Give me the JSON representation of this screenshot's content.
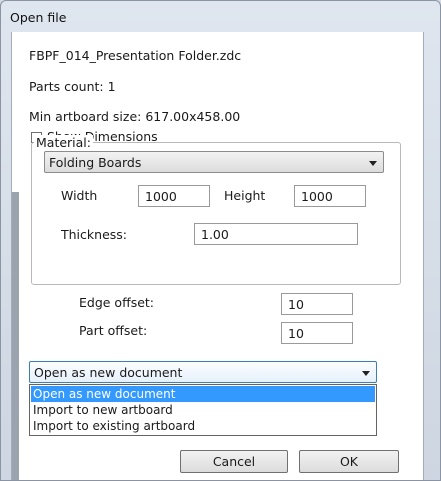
{
  "window": {
    "title": "Open file"
  },
  "info": {
    "filename": "FBPF_014_Presentation Folder.zdc",
    "parts_count": "Parts count:  1",
    "min_artboard": "Min artboard size:  617.00x458.00"
  },
  "show_dimensions": {
    "label": "Show Dimensions",
    "checked": false
  },
  "material": {
    "title": "Material:",
    "selected": "Folding Boards",
    "width_label": "Width",
    "width_value": "1000",
    "height_label": "Height",
    "height_value": "1000",
    "thickness_label": "Thickness:",
    "thickness_value": "1.00"
  },
  "offsets": {
    "edge_label": "Edge offset:",
    "edge_value": "10",
    "part_label": "Part offset:",
    "part_value": "10"
  },
  "open_mode": {
    "selected": "Open as new document",
    "options": [
      "Open as new document",
      "Import to new artboard",
      "Import to existing artboard"
    ]
  },
  "buttons": {
    "cancel": "Cancel",
    "ok": "OK"
  }
}
